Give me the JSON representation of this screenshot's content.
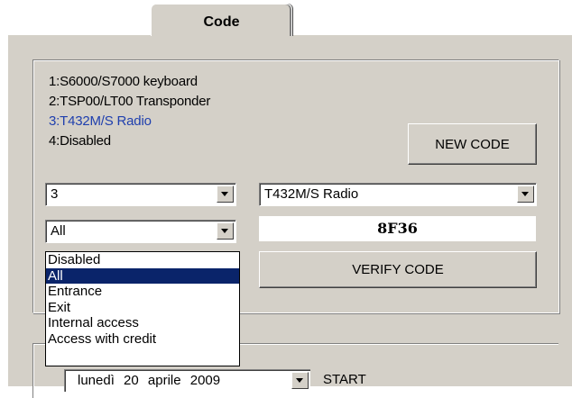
{
  "tab": {
    "label": "Code"
  },
  "options": [
    {
      "text": "1:S6000/S7000 keyboard",
      "selected": false
    },
    {
      "text": "2:TSP00/LT00 Transponder",
      "selected": false
    },
    {
      "text": "3:T432M/S Radio",
      "selected": true
    },
    {
      "text": "4:Disabled",
      "selected": false
    }
  ],
  "buttons": {
    "new_code": "NEW CODE",
    "verify_code": "VERIFY CODE"
  },
  "device_select": {
    "value": "3"
  },
  "device_type_select": {
    "value": "T432M/S Radio"
  },
  "access_select": {
    "value": "All",
    "options": [
      "Disabled",
      "All",
      "Entrance",
      "Exit",
      "Internal access",
      "Access with credit"
    ],
    "highlighted": "All"
  },
  "code_display": {
    "value": "8F36"
  },
  "date_picker": {
    "value": "lunedì   20   aprile   2009"
  },
  "start_label": "START",
  "colors": {
    "selected_text": "#1f3fae",
    "highlight_bg": "#0a246a",
    "face": "#d4d0c8"
  }
}
